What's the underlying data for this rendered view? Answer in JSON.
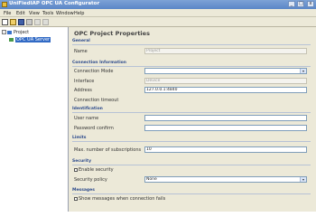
{
  "window": {
    "title": "UniFiedIAP OPC UA Configurator",
    "min": "_",
    "max": "□",
    "close": "x"
  },
  "menu": [
    "File",
    "Edit",
    "View",
    "Tools",
    "Window",
    "Help"
  ],
  "toolbar": [
    "new-icon",
    "open-icon",
    "save-icon",
    "cut-icon",
    "undo-icon",
    "redo-icon"
  ],
  "tree": {
    "root": "Project",
    "child": "OPC UA Server"
  },
  "panel": {
    "title": "OPC Project Properties",
    "general": {
      "label": "General",
      "name_label": "Name",
      "name_value": "Project"
    },
    "conn": {
      "label": "Connection Information",
      "mode_label": "Connection Mode",
      "interface_label": "Interface",
      "interface_value": "Device",
      "address_label": "Address",
      "address_value": "127.0.0.1:4840",
      "timeout_label": "Connection timeout"
    },
    "id": {
      "label": "Identification",
      "user_label": "User name",
      "pass_label": "Password confirm"
    },
    "limits": {
      "label": "Limits",
      "max_label": "Max. number of subscriptions",
      "max_value": "10"
    },
    "security": {
      "label": "Security",
      "enable_label": "Enable security",
      "policy_label": "Security policy",
      "policy_value": "None"
    },
    "notify": {
      "label": "Messages",
      "enable_label": "Show messages when connection fails"
    }
  }
}
